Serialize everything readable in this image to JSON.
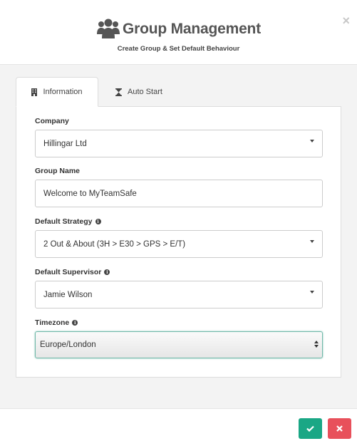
{
  "header": {
    "title": "Group Management",
    "subtitle": "Create Group & Set Default Behaviour",
    "close_label": "×"
  },
  "tabs": [
    {
      "label": "Information",
      "icon": "building-icon",
      "active": true
    },
    {
      "label": "Auto Start",
      "icon": "hourglass-icon",
      "active": false
    }
  ],
  "form": {
    "company": {
      "label": "Company",
      "value": "Hillingar Ltd"
    },
    "group_name": {
      "label": "Group Name",
      "value": "Welcome to MyTeamSafe"
    },
    "default_strategy": {
      "label": "Default Strategy",
      "value": "2 Out & About (3H > E30 > GPS > E/T)"
    },
    "default_supervisor": {
      "label": "Default Supervisor",
      "value": "Jamie Wilson"
    },
    "timezone": {
      "label": "Timezone",
      "value": "Europe/London"
    }
  },
  "info_glyph": "i",
  "footer": {
    "ok_icon": "check-icon",
    "cancel_icon": "times-icon"
  },
  "colors": {
    "ok": "#1aa785",
    "cancel": "#e8505b",
    "focus_border": "#6fb8a8"
  }
}
